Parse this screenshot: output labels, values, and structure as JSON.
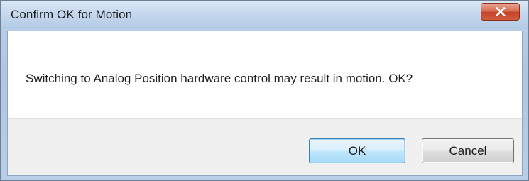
{
  "window": {
    "title": "Confirm OK for Motion"
  },
  "message": {
    "text": "Switching to Analog Position hardware control may result in motion.  OK?"
  },
  "buttons": {
    "ok_label": "OK",
    "cancel_label": "Cancel"
  },
  "icons": {
    "close": "close-icon"
  },
  "colors": {
    "close_button": "#c2442a",
    "default_button_border": "#3c7fb1",
    "dialog_frame": "#b7cde6"
  }
}
